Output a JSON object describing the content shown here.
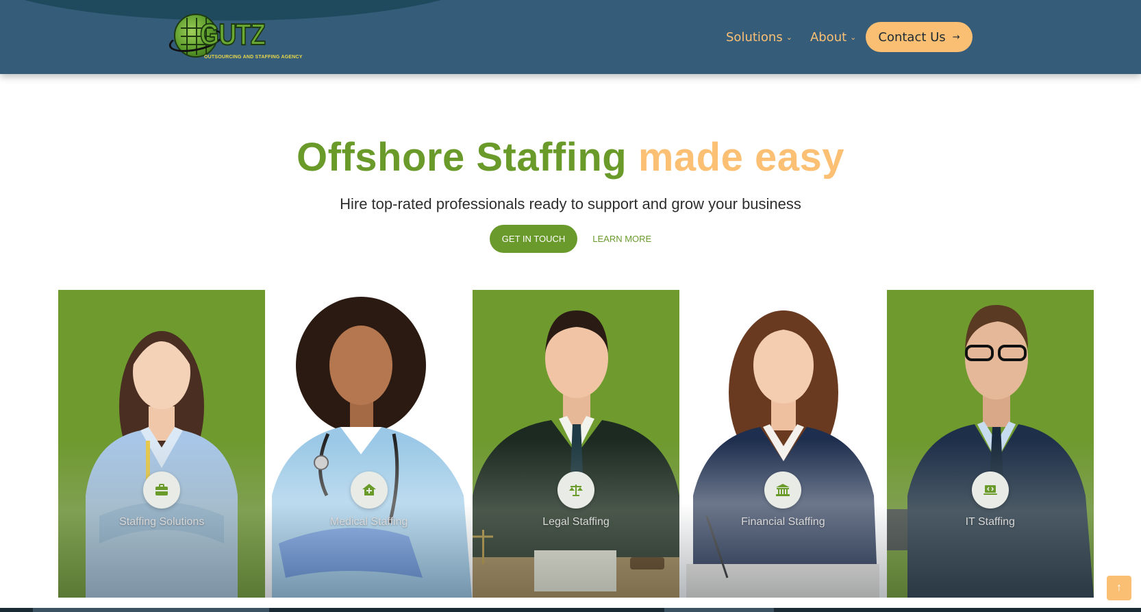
{
  "header": {
    "logo_word": "GUTZ",
    "logo_tagline": "OUTSOURCING AND STAFFING AGENCY",
    "nav": [
      {
        "label": "Solutions"
      },
      {
        "label": "About"
      }
    ],
    "contact_label": "Contact Us",
    "colors": {
      "bar": "#355c79",
      "accent": "#fbc074"
    }
  },
  "hero": {
    "title_part1": "Offshore Staffing",
    "title_part2": "made easy",
    "subtitle": "Hire top-rated professionals ready to support and grow your business",
    "primary_cta": "GET IN TOUCH",
    "secondary_cta": "LEARN MORE",
    "colors": {
      "green": "#6a9a2a",
      "orange": "#fbc074"
    }
  },
  "cards": [
    {
      "label": "Staffing Solutions",
      "icon": "briefcase-icon",
      "bg": "green"
    },
    {
      "label": "Medical Staffing",
      "icon": "medical-house-icon",
      "bg": "white"
    },
    {
      "label": "Legal Staffing",
      "icon": "scales-icon",
      "bg": "green"
    },
    {
      "label": "Financial Staffing",
      "icon": "bank-icon",
      "bg": "white"
    },
    {
      "label": "IT Staffing",
      "icon": "laptop-code-icon",
      "bg": "green"
    }
  ],
  "scroll_top_icon": "arrow-up-icon"
}
